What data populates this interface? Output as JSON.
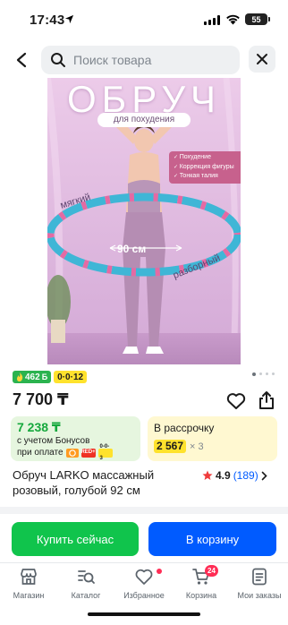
{
  "status_bar": {
    "time": "17:43",
    "battery": "55"
  },
  "search": {
    "placeholder": "Поиск товара"
  },
  "product_image": {
    "title": "ОБРУЧ",
    "subtitle": "для похудения",
    "benefits": [
      "Похудение",
      "Коррекция фигуры",
      "Тонкая талия"
    ],
    "label_soft": "мягкий",
    "label_size": "90 см",
    "label_detachable": "разборный",
    "ring_color_primary": "#3fb6d6",
    "ring_color_secondary": "#e46aa3"
  },
  "badges": {
    "bonus": "462",
    "split": "0·0·12"
  },
  "price": "7 700 ₸",
  "bonus_card": {
    "amount": "7 238 ₸",
    "line1": "с учетом Бонусов",
    "line2": "при оплате",
    "chip1": "kaspi",
    "chip2": "RED+",
    "chip3": "0-0-3"
  },
  "installment_card": {
    "title": "В рассрочку",
    "amount": "2 567",
    "multiplier": "× 3"
  },
  "product_name": "Обруч LARKO массажный розовый, голубой 92 см",
  "rating": {
    "score": "4.9",
    "reviews": "(189)"
  },
  "actions": {
    "buy_now": "Купить сейчас",
    "add_to_cart": "В корзину"
  },
  "nav": {
    "items": [
      {
        "label": "Магазин",
        "icon": "store-icon"
      },
      {
        "label": "Каталог",
        "icon": "catalog-search-icon"
      },
      {
        "label": "Избранное",
        "icon": "heart-icon"
      },
      {
        "label": "Корзина",
        "icon": "cart-icon",
        "badge": "24"
      },
      {
        "label": "Мои заказы",
        "icon": "orders-icon"
      }
    ]
  },
  "colors": {
    "accent_green": "#10c44c",
    "accent_blue": "#005bff",
    "brand_yellow": "#ffe22d",
    "rating_star": "#ef3b3b"
  }
}
